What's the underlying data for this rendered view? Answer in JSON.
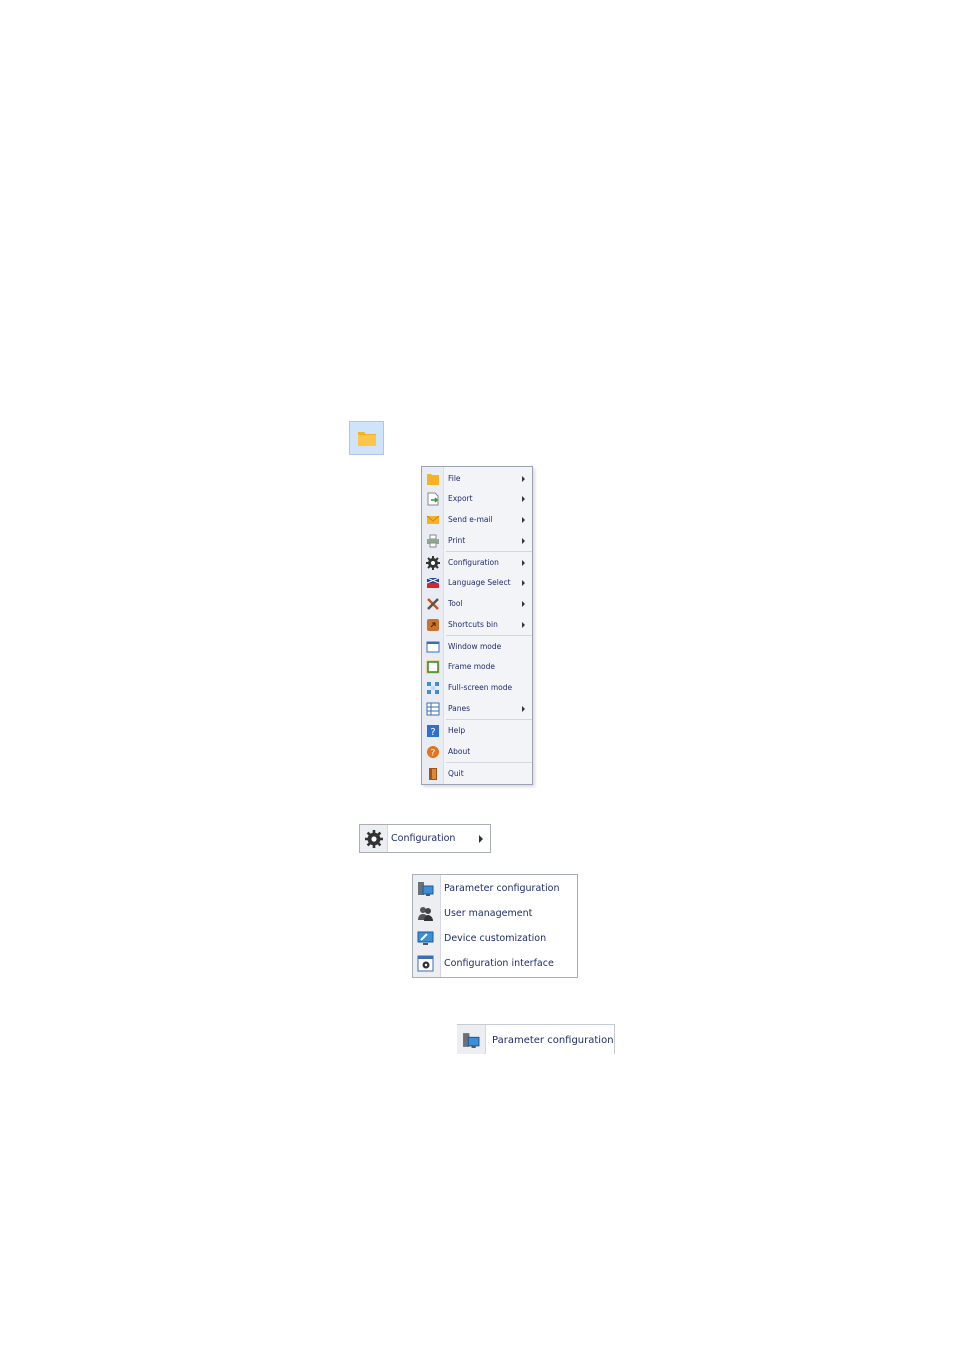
{
  "main_menu": {
    "items": [
      {
        "label": "File",
        "icon": "folder-icon",
        "submenu": true
      },
      {
        "label": "Export",
        "icon": "export-icon",
        "submenu": true
      },
      {
        "label": "Send e-mail",
        "icon": "envelope-icon",
        "submenu": true
      },
      {
        "label": "Print",
        "icon": "printer-icon",
        "submenu": true
      },
      {
        "label": "Configuration",
        "icon": "gear-icon",
        "submenu": true
      },
      {
        "label": "Language Select",
        "icon": "flag-icon",
        "submenu": true
      },
      {
        "label": "Tool",
        "icon": "tools-icon",
        "submenu": true
      },
      {
        "label": "Shortcuts bin",
        "icon": "shortcuts-bin-icon",
        "submenu": true
      },
      {
        "label": "Window mode",
        "icon": "window-icon",
        "submenu": false
      },
      {
        "label": "Frame mode",
        "icon": "frame-icon",
        "submenu": false
      },
      {
        "label": "Full-screen mode",
        "icon": "fullscreen-icon",
        "submenu": false
      },
      {
        "label": "Panes",
        "icon": "panes-icon",
        "submenu": true
      },
      {
        "label": "Help",
        "icon": "help-icon",
        "submenu": false
      },
      {
        "label": "About",
        "icon": "about-icon",
        "submenu": false
      },
      {
        "label": "Quit",
        "icon": "exit-door-icon",
        "submenu": false
      }
    ]
  },
  "config_bar": {
    "label": "Configuration",
    "icon": "gear-icon"
  },
  "config_submenu": {
    "items": [
      {
        "label": "Parameter configuration",
        "icon": "parameter-config-icon"
      },
      {
        "label": "User management",
        "icon": "users-icon"
      },
      {
        "label": "Device customization",
        "icon": "device-customization-icon"
      },
      {
        "label": "Configuration interface",
        "icon": "config-interface-icon"
      }
    ]
  },
  "param_bar": {
    "label": "Parameter configuration",
    "icon": "parameter-config-icon"
  },
  "colors": {
    "menu_text": "#1f2d6b",
    "highlight": "#cfe3fb",
    "folder": "#f5b324"
  }
}
